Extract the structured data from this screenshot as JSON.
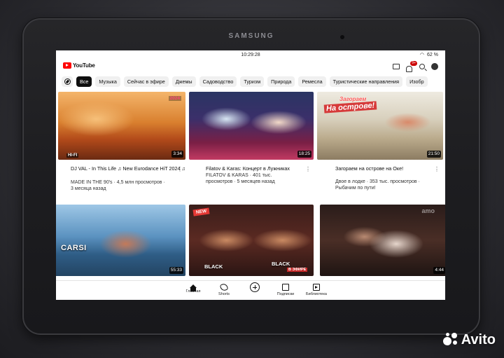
{
  "device": {
    "brand": "SAMSUNG"
  },
  "status": {
    "time": "10:29:28",
    "battery": "62 %"
  },
  "app": {
    "name": "YouTube",
    "notifications": "9+"
  },
  "chips": [
    "Все",
    "Музыка",
    "Сейчас в эфире",
    "Джемы",
    "Садоводство",
    "Туризм",
    "Природа",
    "Ремесла",
    "Туристические направления",
    "Изобр"
  ],
  "videos": [
    {
      "title": "DJ VAL - In This Life ♫ New Eurodance HiT 2024 ♫",
      "channel_views": "MADE IN THE 90's · 4,5 млн просмотров ·",
      "age": "3 месяца назад",
      "duration": "3:34",
      "badge": "2024"
    },
    {
      "title": "Filatov & Karas: Концерт в Лужниках",
      "channel_views": "FILATOV & KARAS · 401 тыс.",
      "age": "просмотров · 5 месяцев назад",
      "duration": "18:25"
    },
    {
      "title": "Загораем на острове на Оке!",
      "channel_views": "Двое в лодке · 353 тыс. просмотров ·",
      "age": "Рыбачим по пути!",
      "duration": "21:50",
      "overlay1": "Загораем",
      "overlay2": "На острове!"
    },
    {
      "title": "",
      "channel_views": "",
      "age": "",
      "duration": "55:33",
      "overlay": "CARSI"
    },
    {
      "title": "",
      "channel_views": "",
      "age": "",
      "duration": "",
      "overlay_new": "NEW",
      "overlay_black": "BLACK",
      "overlay_air": "В ЭФИРЕ"
    },
    {
      "title": "",
      "channel_views": "",
      "age": "",
      "duration": "4:44",
      "overlay": "amo"
    }
  ],
  "nav": [
    {
      "label": "Главная",
      "icon": "home-icon"
    },
    {
      "label": "Shorts",
      "icon": "shorts-icon"
    },
    {
      "label": "",
      "icon": "create-icon"
    },
    {
      "label": "Подписки",
      "icon": "subscriptions-icon"
    },
    {
      "label": "Библиотека",
      "icon": "library-icon"
    }
  ],
  "watermark": "Avito"
}
